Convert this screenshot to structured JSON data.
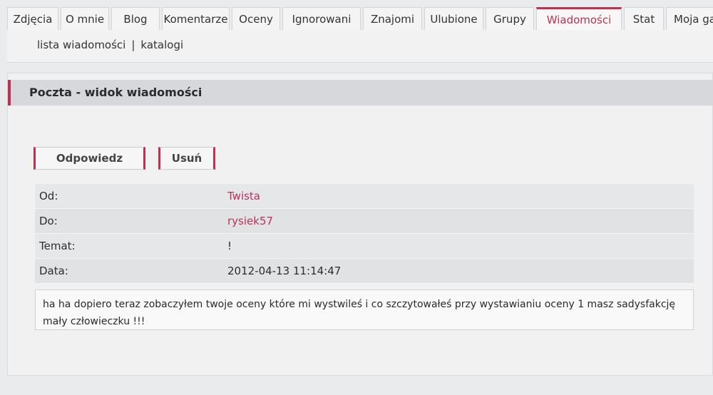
{
  "tabs": [
    {
      "label": "Zdjęcia",
      "active": false
    },
    {
      "label": "O mnie",
      "active": false
    },
    {
      "label": "Blog",
      "active": false
    },
    {
      "label": "Komentarze",
      "active": false
    },
    {
      "label": "Oceny",
      "active": false
    },
    {
      "label": "Ignorowani",
      "active": false
    },
    {
      "label": "Znajomi",
      "active": false
    },
    {
      "label": "Ulubione",
      "active": false
    },
    {
      "label": "Grupy",
      "active": false
    },
    {
      "label": "Wiadomości",
      "active": true
    },
    {
      "label": "Stat",
      "active": false
    },
    {
      "label": "Moja galer",
      "active": false
    }
  ],
  "subnav": {
    "items": [
      "lista wiadomości",
      "katalogi"
    ],
    "separator": "|"
  },
  "panel": {
    "title": "Poczta - widok wiadomości"
  },
  "actions": {
    "reply_label": "Odpowiedz",
    "delete_label": "Usuń"
  },
  "message": {
    "from_label": "Od:",
    "from_value": "Twista",
    "to_label": "Do:",
    "to_value": "rysiek57",
    "subject_label": "Temat:",
    "subject_value": "!",
    "date_label": "Data:",
    "date_value": "2012-04-13 11:14:47",
    "body_line1": "ha ha dopiero teraz zobaczyłem twoje oceny które mi wystwileś i co szczytowałeś przy wystawianiu oceny 1 masz sadysfakcję",
    "body_line2": "mały człowieczku !!!"
  },
  "colors": {
    "accent": "#c0304f",
    "link": "#b7325a"
  }
}
